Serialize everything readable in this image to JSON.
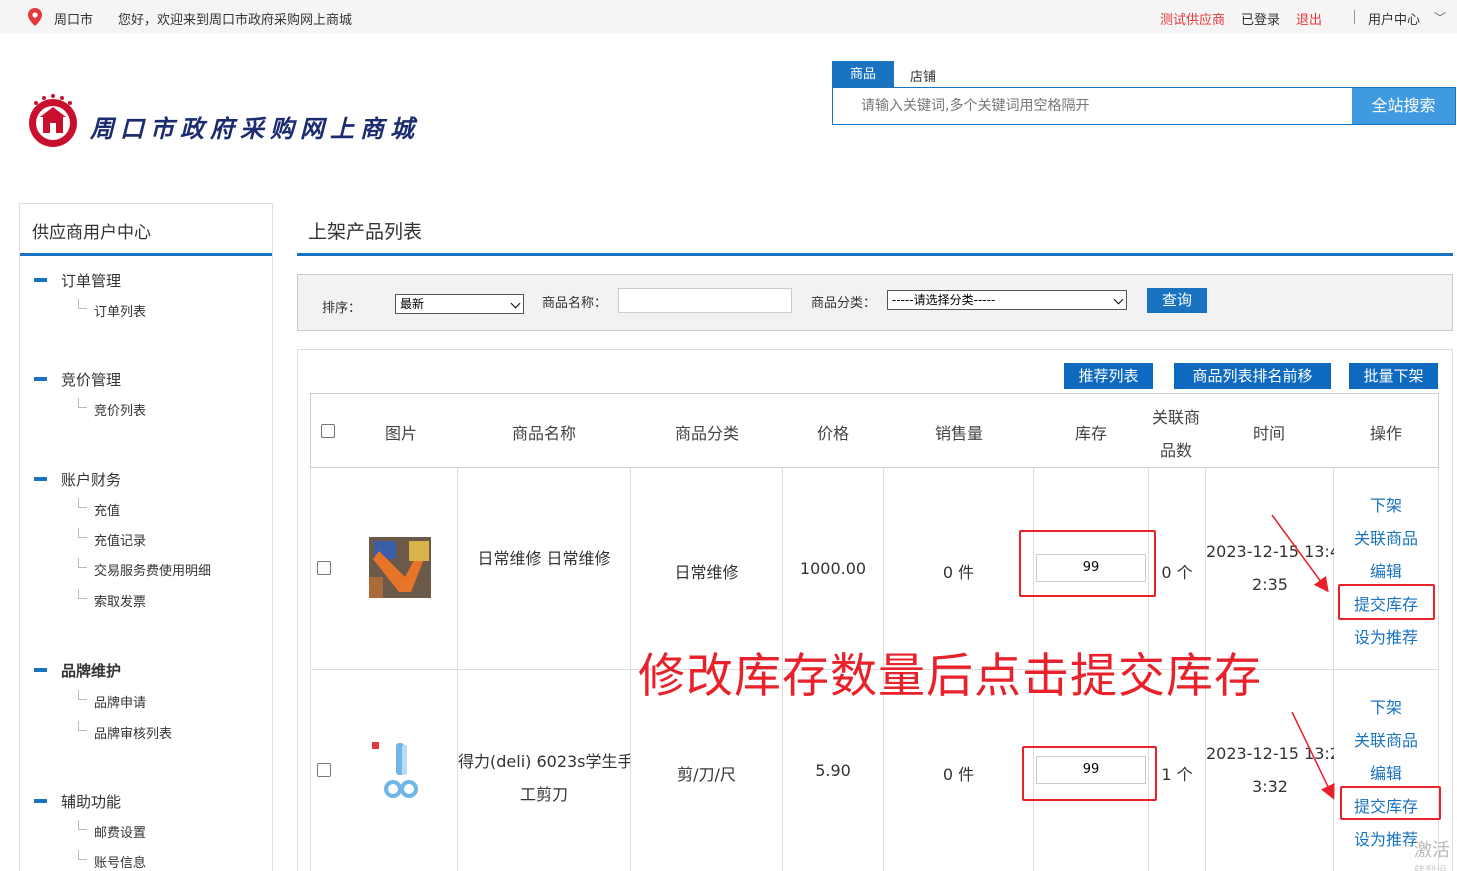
{
  "topbar": {
    "city": "周口市",
    "welcome": "您好，欢迎来到周口市政府采购网上商城",
    "supplier": "测试供应商",
    "logged_in": "已登录",
    "logout": "退出",
    "user_center": "用户中心"
  },
  "logo": {
    "text": "周口市政府采购网上商城"
  },
  "search": {
    "tab_products": "商品",
    "tab_stores": "店铺",
    "placeholder": "请输入关键词,多个关键词用空格隔开",
    "button": "全站搜索"
  },
  "sidebar": {
    "title": "供应商用户中心",
    "groups": [
      {
        "label": "订单管理",
        "items": [
          "订单列表"
        ]
      },
      {
        "label": "竞价管理",
        "items": [
          "竞价列表"
        ]
      },
      {
        "label": "账户财务",
        "items": [
          "充值",
          "充值记录",
          "交易服务费使用明细",
          "索取发票"
        ]
      },
      {
        "label": "品牌维护",
        "items": [
          "品牌申请",
          "品牌审核列表"
        ]
      },
      {
        "label": "辅助功能",
        "items": [
          "邮费设置",
          "账号信息"
        ]
      }
    ]
  },
  "main": {
    "title": "上架产品列表",
    "filter": {
      "sort_label": "排序：",
      "sort_value": "最新",
      "name_label": "商品名称：",
      "category_label": "商品分类：",
      "category_value": "-----请选择分类-----",
      "query_button": "查询"
    },
    "actions": {
      "recommend_list": "推荐列表",
      "rank_forward": "商品列表排名前移",
      "batch_off": "批量下架"
    },
    "columns": {
      "image": "图片",
      "name": "商品名称",
      "category": "商品分类",
      "price": "价格",
      "sales": "销售量",
      "stock": "库存",
      "related_1": "关联商",
      "related_2": "品数",
      "time": "时间",
      "ops": "操作"
    },
    "rows": [
      {
        "name": "日常维修 日常维修",
        "category": "日常维修",
        "price": "1000.00",
        "sales": "0 件",
        "stock": "99",
        "related": "0 个",
        "time_1": "2023-12-15 13:4",
        "time_2": "2:35",
        "ops": [
          "下架",
          "关联商品",
          "编辑",
          "提交库存",
          "设为推荐"
        ]
      },
      {
        "name_1": "得力(deli) 6023s学生手",
        "name_2": "工剪刀",
        "category": "剪/刀/尺",
        "price": "5.90",
        "sales": "0 件",
        "stock": "99",
        "related": "1 个",
        "time_1": "2023-12-15 13:2",
        "time_2": "3:32",
        "ops": [
          "下架",
          "关联商品",
          "编辑",
          "提交库存",
          "设为推荐"
        ]
      }
    ]
  },
  "annotation": "修改库存数量后点击提交库存",
  "watermark": {
    "line1": "激活",
    "line2": "转到设"
  }
}
